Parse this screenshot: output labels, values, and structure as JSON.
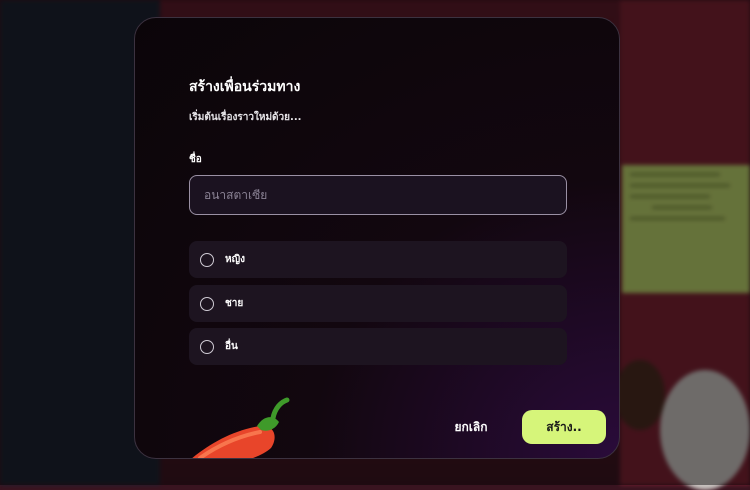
{
  "modal": {
    "title": "สร้างเพื่อนร่วมทาง",
    "subtitle": "เริ่มต้นเรื่องราวใหม่ด้วย...",
    "name_label": "ชื่อ",
    "name_placeholder": "อนาสตาเซีย",
    "gender_options": [
      {
        "label": "หญิง",
        "selected": false
      },
      {
        "label": "ชาย",
        "selected": false
      },
      {
        "label": "อื่น",
        "selected": false
      }
    ],
    "cancel_label": "ยกเลิก",
    "create_label": "สร้าง.."
  },
  "colors": {
    "accent": "#d6f57a",
    "modal_bg": "#0b0509",
    "option_bg": "#1d1420"
  },
  "icons": [
    "chili-pepper-icon",
    "radio-icon"
  ]
}
